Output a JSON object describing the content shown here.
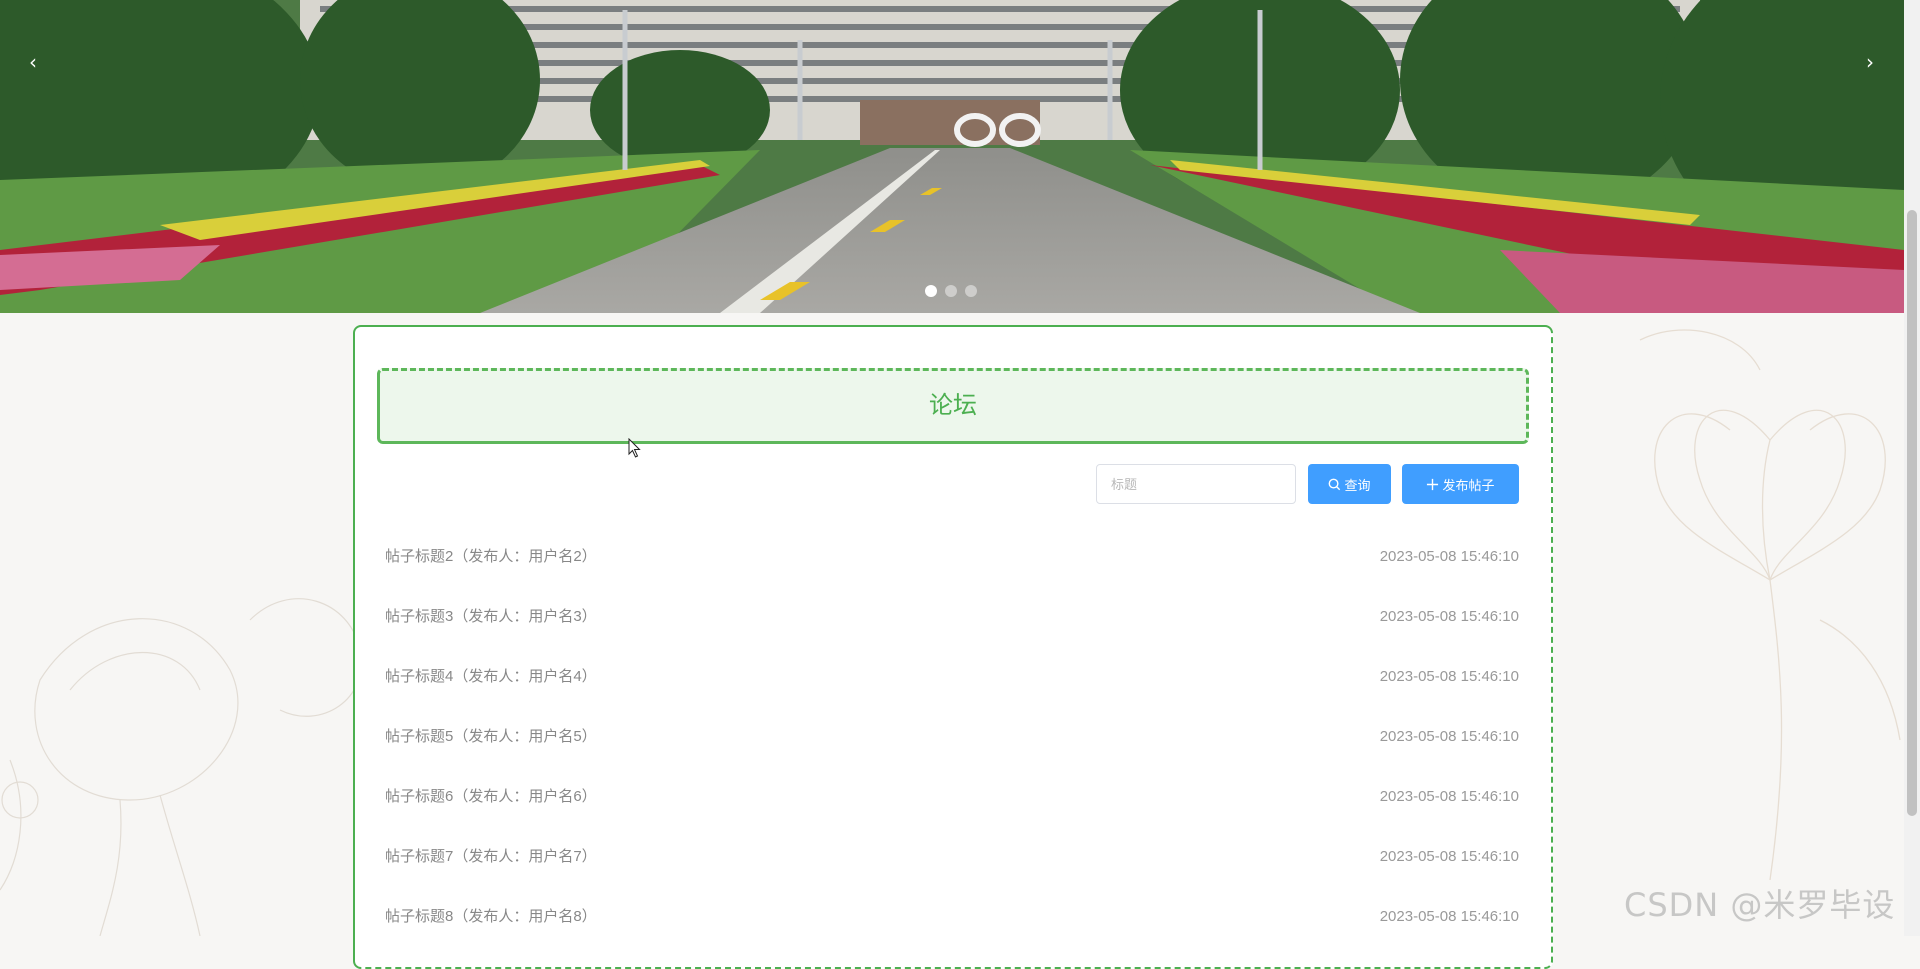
{
  "carousel": {
    "prev_icon": "‹",
    "next_icon": "›",
    "slides_count": 3,
    "active_index": 0
  },
  "forum": {
    "title": "论坛",
    "search": {
      "placeholder": "标题"
    },
    "buttons": {
      "search_label": "查询",
      "publish_label": "发布帖子"
    },
    "posts": [
      {
        "title": "帖子标题2（发布人：用户名2）",
        "time": "2023-05-08 15:46:10"
      },
      {
        "title": "帖子标题3（发布人：用户名3）",
        "time": "2023-05-08 15:46:10"
      },
      {
        "title": "帖子标题4（发布人：用户名4）",
        "time": "2023-05-08 15:46:10"
      },
      {
        "title": "帖子标题5（发布人：用户名5）",
        "time": "2023-05-08 15:46:10"
      },
      {
        "title": "帖子标题6（发布人：用户名6）",
        "time": "2023-05-08 15:46:10"
      },
      {
        "title": "帖子标题7（发布人：用户名7）",
        "time": "2023-05-08 15:46:10"
      },
      {
        "title": "帖子标题8（发布人：用户名8）",
        "time": "2023-05-08 15:46:10"
      }
    ]
  },
  "watermark": "CSDN @米罗毕设",
  "colors": {
    "accent": "#4caf50",
    "button": "#409eff",
    "header_bg": "#edf7ec"
  }
}
